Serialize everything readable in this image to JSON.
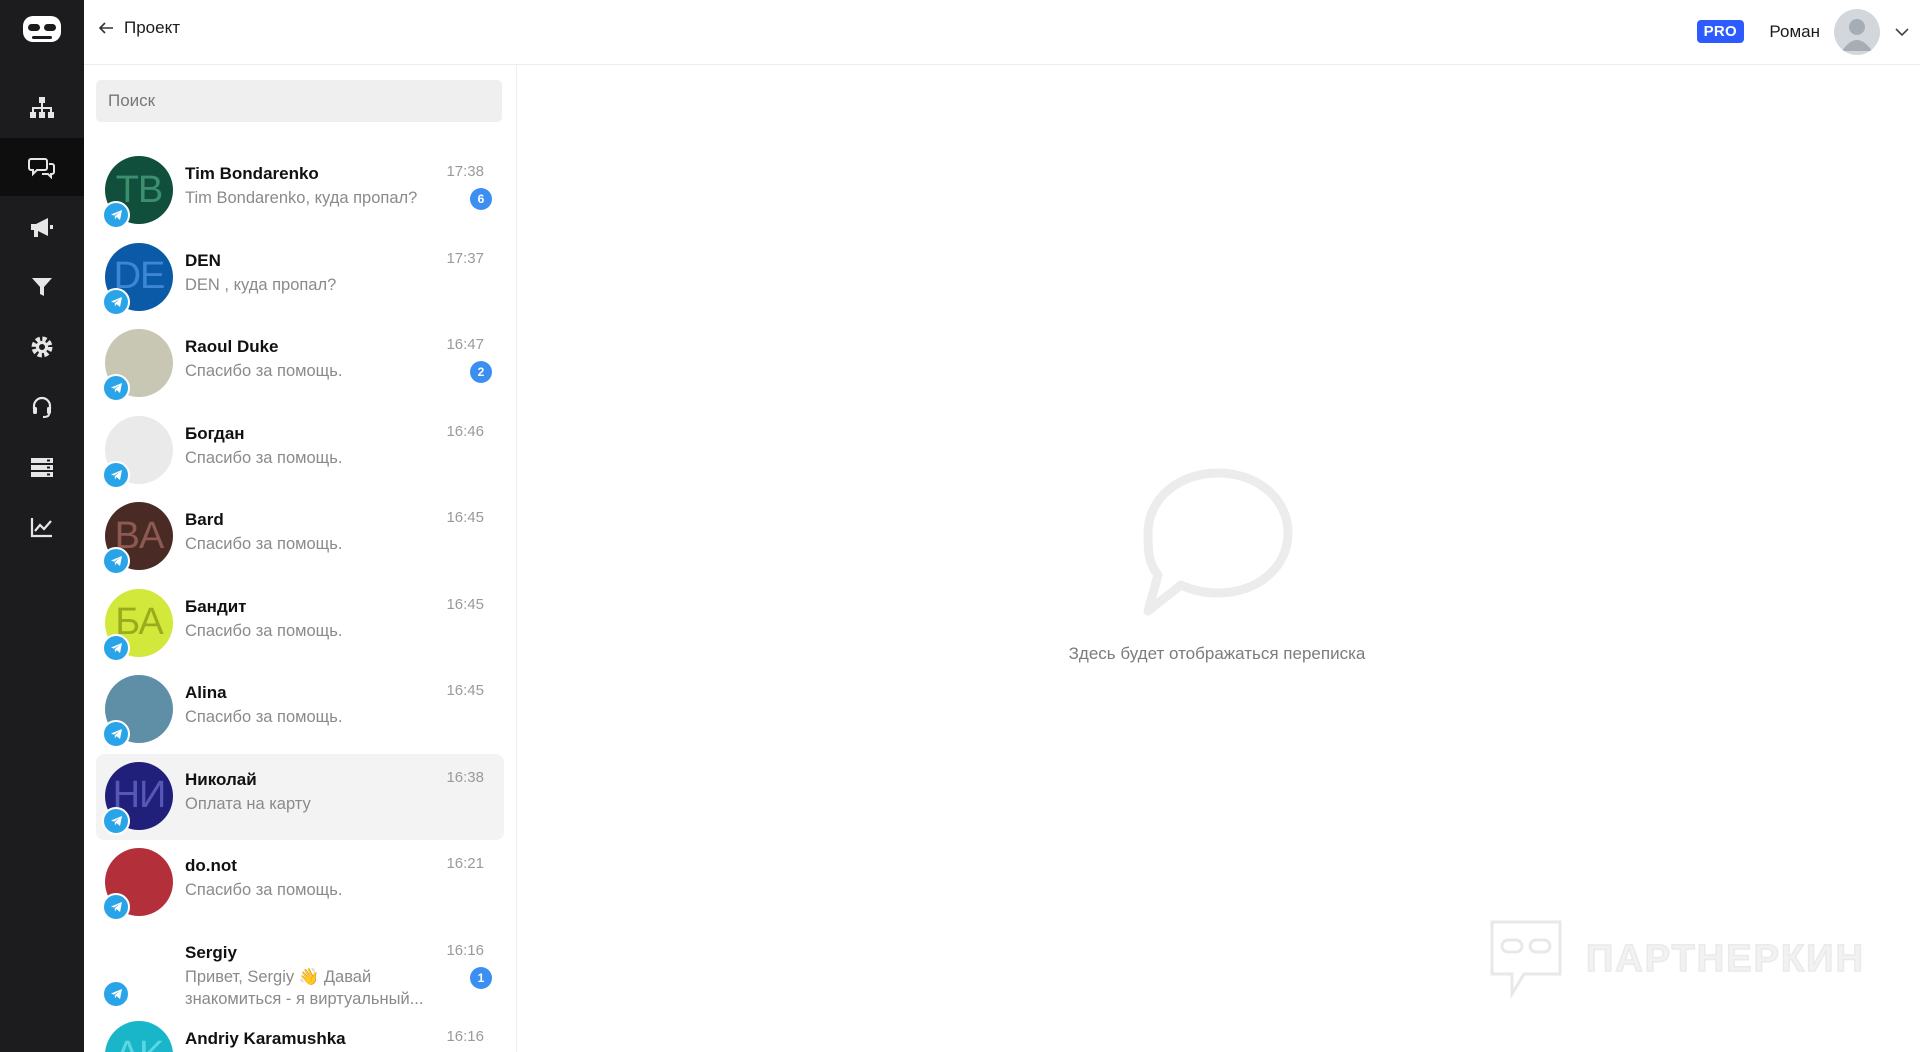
{
  "header": {
    "back_label": "Проект",
    "plan_badge": "PRO",
    "user_name": "Роман"
  },
  "nav": {
    "items": [
      {
        "icon": "sitemap-icon"
      },
      {
        "icon": "chat-icon",
        "active": true
      },
      {
        "icon": "megaphone-icon"
      },
      {
        "icon": "filter-icon"
      },
      {
        "icon": "gear-icon"
      },
      {
        "icon": "headset-icon"
      },
      {
        "icon": "server-icon"
      },
      {
        "icon": "chart-icon"
      }
    ]
  },
  "search": {
    "placeholder": "Поиск",
    "value": ""
  },
  "chats": [
    {
      "name": "Tim Bondarenko",
      "message": "Tim Bondarenko, куда пропал?",
      "time": "17:38",
      "unread": "6",
      "initials": "TB",
      "bg": "#0f4f3b",
      "fg": "#3b8f6f"
    },
    {
      "name": "DEN",
      "message": "DEN , куда пропал?",
      "time": "17:37",
      "unread": "",
      "initials": "DE",
      "bg": "#0a5aa8",
      "fg": "#3d86d6"
    },
    {
      "name": "Raoul Duke",
      "message": "Спасибо за помощь.",
      "time": "16:47",
      "unread": "2",
      "initials": "",
      "bg": "#c8c7b3",
      "fg": "#000"
    },
    {
      "name": "Богдан",
      "message": "Спасибо за помощь.",
      "time": "16:46",
      "unread": "",
      "initials": "",
      "bg": "#eaeaea",
      "fg": "#000"
    },
    {
      "name": "Bard",
      "message": "Спасибо за помощь.",
      "time": "16:45",
      "unread": "",
      "initials": "BA",
      "bg": "#4a2a25",
      "fg": "#8c5a50"
    },
    {
      "name": "Бандит",
      "message": "Спасибо за помощь.",
      "time": "16:45",
      "unread": "",
      "initials": "БА",
      "bg": "#d2e83a",
      "fg": "#9aac1e"
    },
    {
      "name": "Alina",
      "message": "Спасибо за помощь.",
      "time": "16:45",
      "unread": "",
      "initials": "",
      "bg": "#5f8fa6",
      "fg": "#000"
    },
    {
      "name": "Николай",
      "message": "Оплата на карту",
      "time": "16:38",
      "unread": "",
      "initials": "НИ",
      "bg": "#20207a",
      "fg": "#5757b8",
      "selected": true
    },
    {
      "name": "do.not",
      "message": "Спасибо за помощь.",
      "time": "16:21",
      "unread": "",
      "initials": "",
      "bg": "#b3303a",
      "fg": "#000"
    },
    {
      "name": "Sergiy",
      "message": "Привет, Sergiy 👋 Давай знакомиться - я виртуальный...",
      "time": "16:16",
      "unread": "1",
      "initials": "",
      "bg": "#ffffff",
      "fg": "#000"
    },
    {
      "name": "Andriy Karamushka",
      "message": "",
      "time": "16:16",
      "unread": "",
      "initials": "AK",
      "bg": "#19b6c9",
      "fg": "#5fd5e2"
    }
  ],
  "empty_state": {
    "text": "Здесь будет отображаться переписка",
    "icon": "speech-bubble-icon"
  },
  "watermark": {
    "text": "ПАРТНЕРКИН"
  },
  "colors": {
    "nav_bg": "#1c1c1e",
    "accent": "#2e5bff",
    "badge": "#3b8ff0",
    "telegram": "#2aa4e8"
  }
}
